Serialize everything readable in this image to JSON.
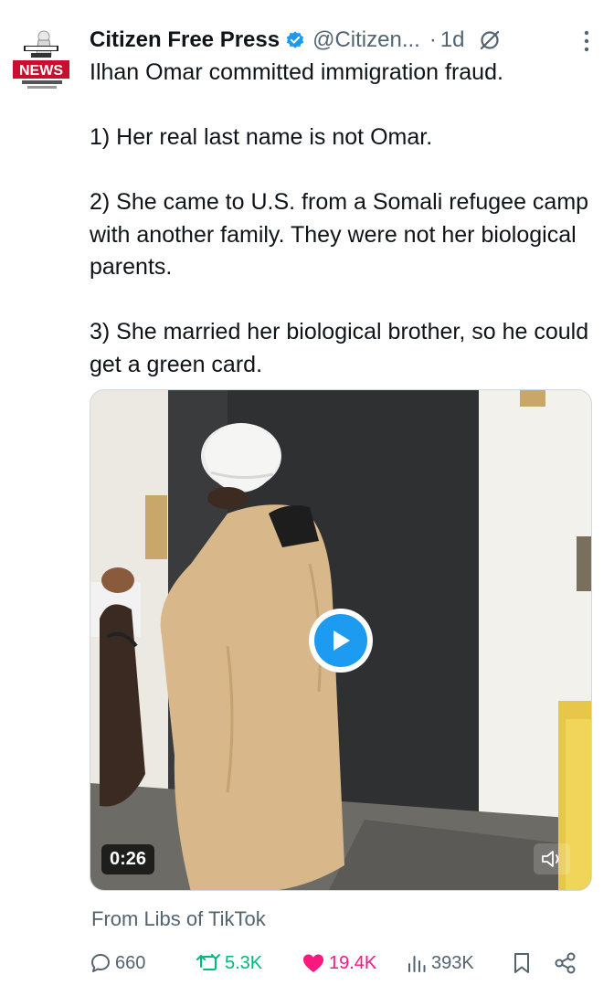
{
  "author": {
    "display_name": "Citizen Free Press",
    "handle": "@Citizen...",
    "separator": "·",
    "time": "1d",
    "avatar_icon": "citizen-free-press-news-logo",
    "verified_icon": "verified-badge-icon",
    "verified_color": "#1d9bf0"
  },
  "tweet": {
    "lines": [
      "Ilhan Omar committed immigration fraud.",
      "1) Her real last name is not Omar.",
      "2) She came to U.S. from a Somali refugee camp with another family. They were not her biological parents.",
      "3) She married her biological brother, so he could get a green card."
    ]
  },
  "media": {
    "type": "video",
    "duration": "0:26",
    "play_icon": "play-icon",
    "mute_icon": "speaker-muted-icon",
    "accent": "#1d9bf0"
  },
  "source": "From Libs of TikTok",
  "actions": {
    "replies": "660",
    "reposts": "5.3K",
    "likes": "19.4K",
    "views": "393K",
    "reply_color": "#536471",
    "repost_color": "#00ba7c",
    "like_color": "#f91880",
    "views_color": "#536471"
  }
}
